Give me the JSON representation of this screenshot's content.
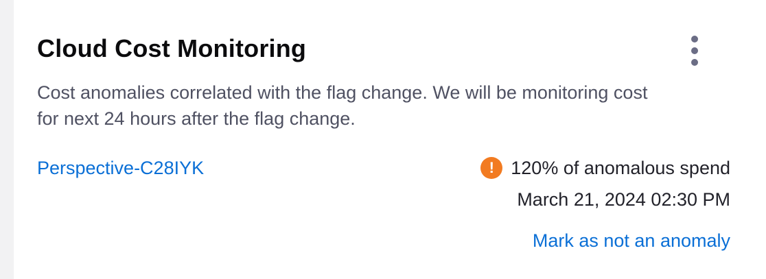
{
  "card": {
    "title": "Cloud Cost Monitoring",
    "description": "Cost anomalies correlated with the flag change. We will be monitoring cost for next 24 hours after the flag change.",
    "perspective_link": "Perspective-C28IYK",
    "anomaly": {
      "icon": "exclamation-circle-icon",
      "spend_text": "120% of anomalous spend",
      "date": "March 21, 2024 02:30 PM",
      "mark_link": "Mark as not an anomaly"
    },
    "menu_icon": "more-vertical-icon"
  },
  "colors": {
    "title": "#0b0b0d",
    "description": "#4f5162",
    "link": "#0a6fd6",
    "warning": "#f27b21",
    "menu_dots": "#6b6d85",
    "background": "#f2f2f3",
    "card": "#ffffff"
  }
}
